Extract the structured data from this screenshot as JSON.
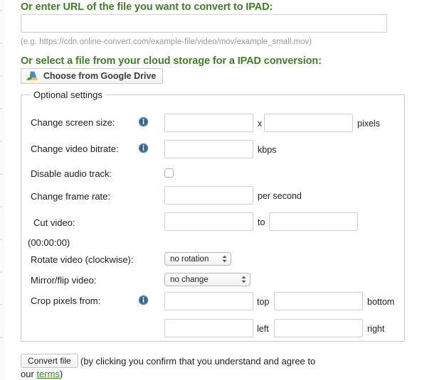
{
  "url_section": {
    "heading": "Or enter URL of the file you want to convert to IPAD:",
    "input_value": "",
    "input_placeholder": "",
    "hint": "(e.g. https://cdn.online-convert.com/example-file/video/mov/example_small.mov)"
  },
  "cloud_section": {
    "heading": "Or select a file from your cloud storage for a IPAD conversion:",
    "google_drive_button": "Choose from Google Drive"
  },
  "optional_settings": {
    "legend": "Optional settings",
    "rows": {
      "screen_size": {
        "label": "Change screen size:",
        "info_icon": "info-icon",
        "width_value": "",
        "separator": "x",
        "height_value": "",
        "unit": "pixels"
      },
      "video_bitrate": {
        "label": "Change video bitrate:",
        "info_icon": "info-icon",
        "value": "",
        "unit": "kbps"
      },
      "disable_audio": {
        "label": "Disable audio track:",
        "checked": false
      },
      "frame_rate": {
        "label": "Change frame rate:",
        "value": "",
        "unit": "per second"
      },
      "cut_video": {
        "label": "Cut video:",
        "format_hint": "(00:00:00)",
        "from_value": "",
        "separator": "to",
        "to_value": ""
      },
      "rotate_video": {
        "label": "Rotate video (clockwise):",
        "selected": "no rotation"
      },
      "mirror_flip": {
        "label": "Mirror/flip video:",
        "selected": "no change"
      },
      "crop": {
        "label": "Crop pixels from:",
        "info_icon": "info-icon",
        "top_value": "",
        "top_unit": "top",
        "bottom_value": "",
        "bottom_unit": "bottom",
        "left_value": "",
        "left_unit": "left",
        "right_value": "",
        "right_unit": "right"
      }
    }
  },
  "footer": {
    "convert_button": "Convert file",
    "consent_line1": "(by clicking you confirm that you understand and agree to",
    "consent_line2_prefix": "our ",
    "terms_link": "terms",
    "consent_line2_suffix": ")"
  },
  "colors": {
    "heading_green": "#3f7f28",
    "link_green": "#3f7f28",
    "info_icon_blue": "#2e5f8a",
    "border_gray": "#cfcfcf"
  }
}
